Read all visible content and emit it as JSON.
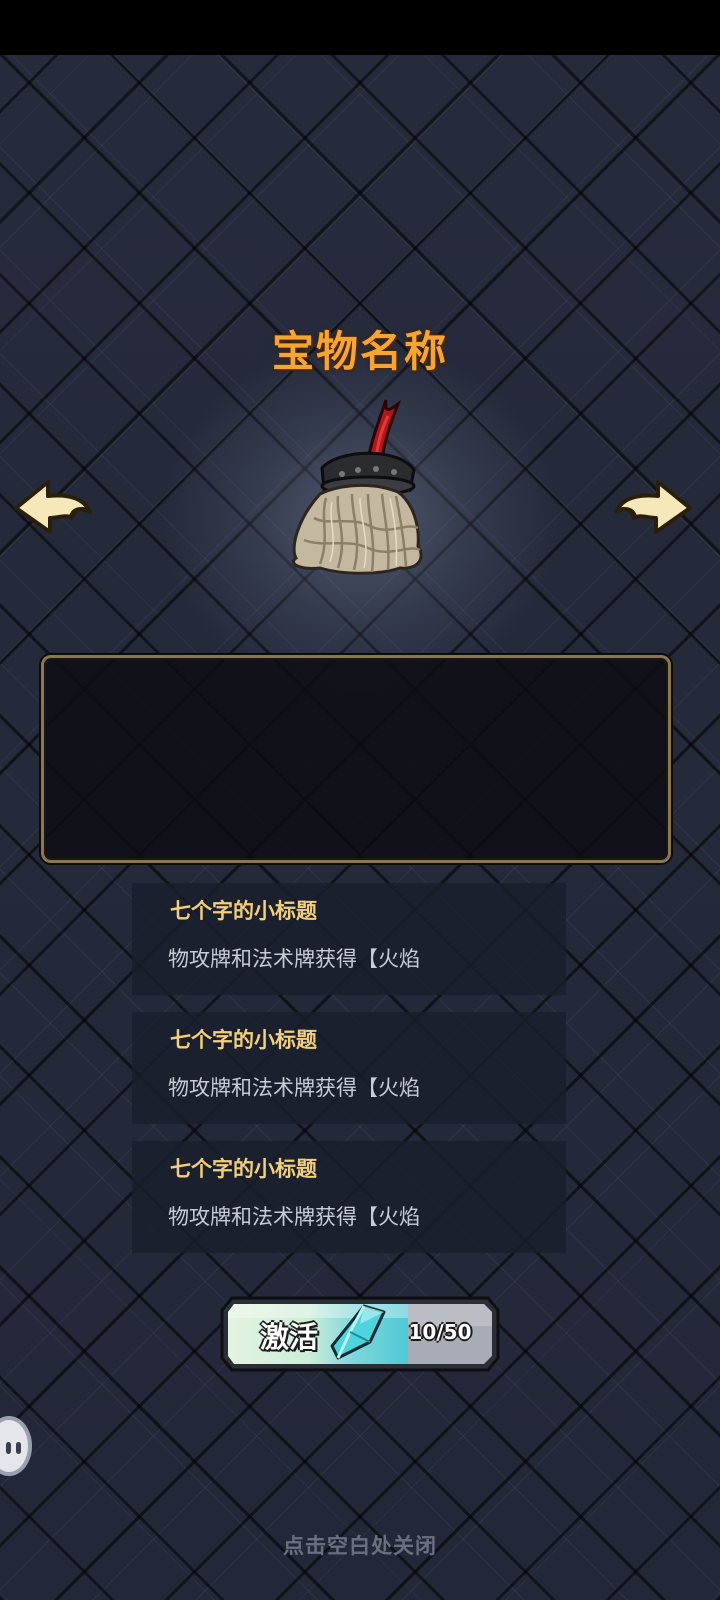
{
  "treasure": {
    "name": "宝物名称",
    "image_icon": "mop-treasure-icon"
  },
  "navigation": {
    "prev_icon": "left-arrow-icon",
    "next_icon": "right-arrow-icon"
  },
  "description": {
    "text": ""
  },
  "entries": [
    {
      "title": "七个字的小标题",
      "text": "物攻牌和法术牌获得【火焰"
    },
    {
      "title": "七个字的小标题",
      "text": "物攻牌和法术牌获得【火焰"
    },
    {
      "title": "七个字的小标题",
      "text": "物攻牌和法术牌获得【火焰"
    }
  ],
  "activate": {
    "label": "激活",
    "currency_icon": "crystal-icon",
    "cost": "10/50"
  },
  "close_hint": "点击空白处关闭",
  "colors": {
    "title": "#f6a532",
    "entry_title": "#f3cf7c",
    "entry_text": "#c9ccd4",
    "button_main": "#d8f0d8",
    "button_accent": "#4fc9d6"
  }
}
